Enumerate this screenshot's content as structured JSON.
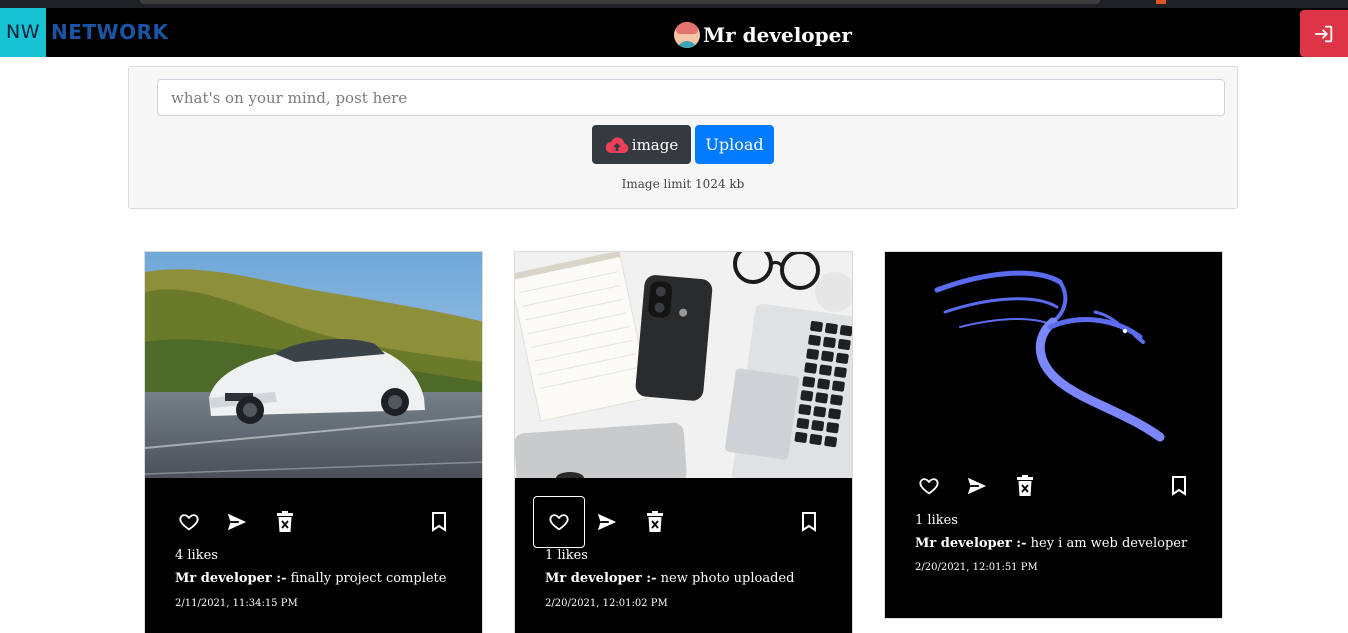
{
  "navbar": {
    "logo_abbr": "NW",
    "logo_text": "NETWORK",
    "username": "Mr developer",
    "icons": {
      "avatar": "avatar-emoji",
      "logout": "logout-icon"
    },
    "colors": {
      "logo_box": "#17c3d3",
      "logo_text": "#1c54a4",
      "logout": "#dc3545"
    }
  },
  "composer": {
    "placeholder": "what's on your mind, post here",
    "value": "",
    "image_button": "image",
    "upload_button": "Upload",
    "limit_note": "Image limit 1024 kb",
    "icons": {
      "image_button": "cloud-upload-icon"
    },
    "colors": {
      "upload": "#007bff",
      "image_button": "#343a40",
      "cloud_icon": "#e94057"
    }
  },
  "posts": [
    {
      "image": "white-sports-car-photo",
      "likes": "4 likes",
      "author": "Mr developer :-",
      "text": " finally project complete",
      "date": "2/11/2021, 11:34:15 PM",
      "like_focused": false
    },
    {
      "image": "desk-phone-notebook-laptop-photo",
      "likes": "1 likes",
      "author": "Mr developer :-",
      "text": " new photo uploaded",
      "date": "2/20/2021, 12:01:02 PM",
      "like_focused": true
    },
    {
      "image": "blue-dragon-logo-on-black",
      "likes": "1 likes",
      "author": "Mr developer :-",
      "text": " hey i am web developer",
      "date": "2/20/2021, 12:01:51 PM",
      "like_focused": false
    }
  ],
  "post_action_icons": [
    "heart-icon",
    "send-icon",
    "delete-icon",
    "bookmark-icon"
  ]
}
